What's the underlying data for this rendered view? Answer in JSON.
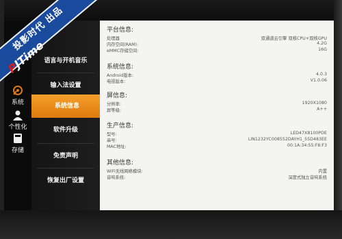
{
  "watermark": {
    "brand_cn": "投影时代",
    "brand_en_p": "P",
    "brand_en_rest": "JTime",
    "brand_suffix": "出品"
  },
  "rail": {
    "items": [
      {
        "label": "系统",
        "icon": "settings-icon"
      },
      {
        "label": "个性化",
        "icon": "user-icon"
      },
      {
        "label": "存储",
        "icon": "storage-icon"
      }
    ]
  },
  "menu": {
    "items": [
      {
        "label": "语言与开机音乐",
        "active": false
      },
      {
        "label": "输入法设置",
        "active": false
      },
      {
        "label": "系统信息",
        "active": true
      },
      {
        "label": "软件升级",
        "active": false
      },
      {
        "label": "免责声明",
        "active": false
      },
      {
        "label": "恢复出厂设置",
        "active": false
      }
    ]
  },
  "info": {
    "platform": {
      "title": "平台信息:",
      "rows": [
        {
          "key": "处理器",
          "value": "双通道云引擎 双核CPU+双核GPU"
        },
        {
          "key": "内存空间(RAM):",
          "value": "4.2G"
        },
        {
          "key": "eMMC存储空间:",
          "value": "16G"
        }
      ]
    },
    "system": {
      "title": "系统信息:",
      "rows": [
        {
          "key": "Android版本:",
          "value": "4.0.3"
        },
        {
          "key": "电视版本:",
          "value": "V1.0.06"
        }
      ]
    },
    "screen": {
      "title": "屏信息:",
      "rows": [
        {
          "key": "分辨率:",
          "value": "1920X1080"
        },
        {
          "key": "屏等级:",
          "value": "A++"
        }
      ]
    },
    "production": {
      "title": "生产信息:",
      "rows": [
        {
          "key": "型号:",
          "value": "LED47X8100PDE"
        },
        {
          "key": "串号:",
          "value": "LIN1232YC008552DAYH1_55D483EE"
        },
        {
          "key": "MAC地址:",
          "value": "00:1A:34:55:F8:F3"
        }
      ]
    },
    "other": {
      "title": "其他信息:",
      "rows": [
        {
          "key": "WiFi无线网络模块:",
          "value": "内置"
        },
        {
          "key": "音响系统:",
          "value": "深度式独立音响系统"
        }
      ]
    }
  }
}
